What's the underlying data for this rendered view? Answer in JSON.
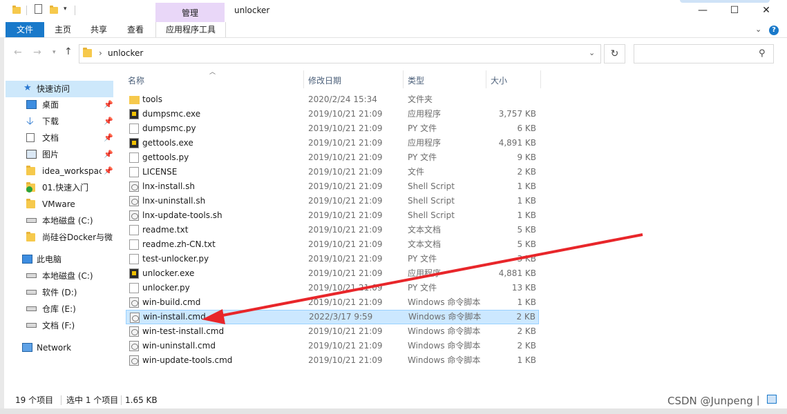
{
  "window": {
    "title": "unlocker",
    "context_tab": "管理",
    "controls": {
      "minimize": "—",
      "maximize": "☐",
      "close": "✕"
    }
  },
  "ribbon": {
    "tabs": [
      "文件",
      "主页",
      "共享",
      "查看",
      "应用程序工具"
    ]
  },
  "address": {
    "path": "unlocker",
    "separator": "›",
    "search_placeholder": ""
  },
  "nav": {
    "quick_access": "快速访问",
    "pinned": [
      {
        "label": "桌面",
        "icon": "desktop-icon",
        "pinned": true
      },
      {
        "label": "下载",
        "icon": "download-icon",
        "pinned": true
      },
      {
        "label": "文档",
        "icon": "documents-icon",
        "pinned": true
      },
      {
        "label": "图片",
        "icon": "pictures-icon",
        "pinned": true
      },
      {
        "label": "idea_workspac",
        "icon": "folder-icon",
        "pinned": true
      },
      {
        "label": "01.快速入门",
        "icon": "folder-check-icon",
        "pinned": false
      },
      {
        "label": "VMware",
        "icon": "folder-icon",
        "pinned": false
      },
      {
        "label": "本地磁盘 (C:)",
        "icon": "drive-icon",
        "pinned": false
      },
      {
        "label": "尚硅谷Docker与微",
        "icon": "folder-icon",
        "pinned": false
      }
    ],
    "this_pc": "此电脑",
    "drives": [
      "本地磁盘 (C:)",
      "软件 (D:)",
      "仓库 (E:)",
      "文档 (F:)"
    ],
    "network": "Network"
  },
  "columns": {
    "name": "名称",
    "date": "修改日期",
    "type": "类型",
    "size": "大小"
  },
  "files": [
    {
      "name": "tools",
      "date": "2020/2/24 15:34",
      "type": "文件夹",
      "size": "",
      "icon": "folder"
    },
    {
      "name": "dumpsmc.exe",
      "date": "2019/10/21 21:09",
      "type": "应用程序",
      "size": "3,757 KB",
      "icon": "exe"
    },
    {
      "name": "dumpsmc.py",
      "date": "2019/10/21 21:09",
      "type": "PY 文件",
      "size": "6 KB",
      "icon": "doc"
    },
    {
      "name": "gettools.exe",
      "date": "2019/10/21 21:09",
      "type": "应用程序",
      "size": "4,891 KB",
      "icon": "exe"
    },
    {
      "name": "gettools.py",
      "date": "2019/10/21 21:09",
      "type": "PY 文件",
      "size": "9 KB",
      "icon": "doc"
    },
    {
      "name": "LICENSE",
      "date": "2019/10/21 21:09",
      "type": "文件",
      "size": "2 KB",
      "icon": "doc"
    },
    {
      "name": "lnx-install.sh",
      "date": "2019/10/21 21:09",
      "type": "Shell Script",
      "size": "1 KB",
      "icon": "cmd"
    },
    {
      "name": "lnx-uninstall.sh",
      "date": "2019/10/21 21:09",
      "type": "Shell Script",
      "size": "1 KB",
      "icon": "cmd"
    },
    {
      "name": "lnx-update-tools.sh",
      "date": "2019/10/21 21:09",
      "type": "Shell Script",
      "size": "1 KB",
      "icon": "cmd"
    },
    {
      "name": "readme.txt",
      "date": "2019/10/21 21:09",
      "type": "文本文档",
      "size": "5 KB",
      "icon": "doc"
    },
    {
      "name": "readme.zh-CN.txt",
      "date": "2019/10/21 21:09",
      "type": "文本文档",
      "size": "5 KB",
      "icon": "doc"
    },
    {
      "name": "test-unlocker.py",
      "date": "2019/10/21 21:09",
      "type": "PY 文件",
      "size": "3 KB",
      "icon": "doc"
    },
    {
      "name": "unlocker.exe",
      "date": "2019/10/21 21:09",
      "type": "应用程序",
      "size": "4,881 KB",
      "icon": "exe"
    },
    {
      "name": "unlocker.py",
      "date": "2019/10/21 21:09",
      "type": "PY 文件",
      "size": "13 KB",
      "icon": "doc"
    },
    {
      "name": "win-build.cmd",
      "date": "2019/10/21 21:09",
      "type": "Windows 命令脚本",
      "size": "1 KB",
      "icon": "cmd"
    },
    {
      "name": "win-install.cmd",
      "date": "2022/3/17 9:59",
      "type": "Windows 命令脚本",
      "size": "2 KB",
      "icon": "cmd",
      "selected": true
    },
    {
      "name": "win-test-install.cmd",
      "date": "2019/10/21 21:09",
      "type": "Windows 命令脚本",
      "size": "2 KB",
      "icon": "cmd"
    },
    {
      "name": "win-uninstall.cmd",
      "date": "2019/10/21 21:09",
      "type": "Windows 命令脚本",
      "size": "2 KB",
      "icon": "cmd"
    },
    {
      "name": "win-update-tools.cmd",
      "date": "2019/10/21 21:09",
      "type": "Windows 命令脚本",
      "size": "1 KB",
      "icon": "cmd"
    }
  ],
  "status": {
    "count": "19 个项目",
    "selected": "选中 1 个项目",
    "size": "1.65 KB"
  },
  "watermark": "CSDN @Junpeng丨",
  "colors": {
    "accent": "#1979ca",
    "selection": "#cce8ff",
    "arrow": "#e8262a"
  }
}
